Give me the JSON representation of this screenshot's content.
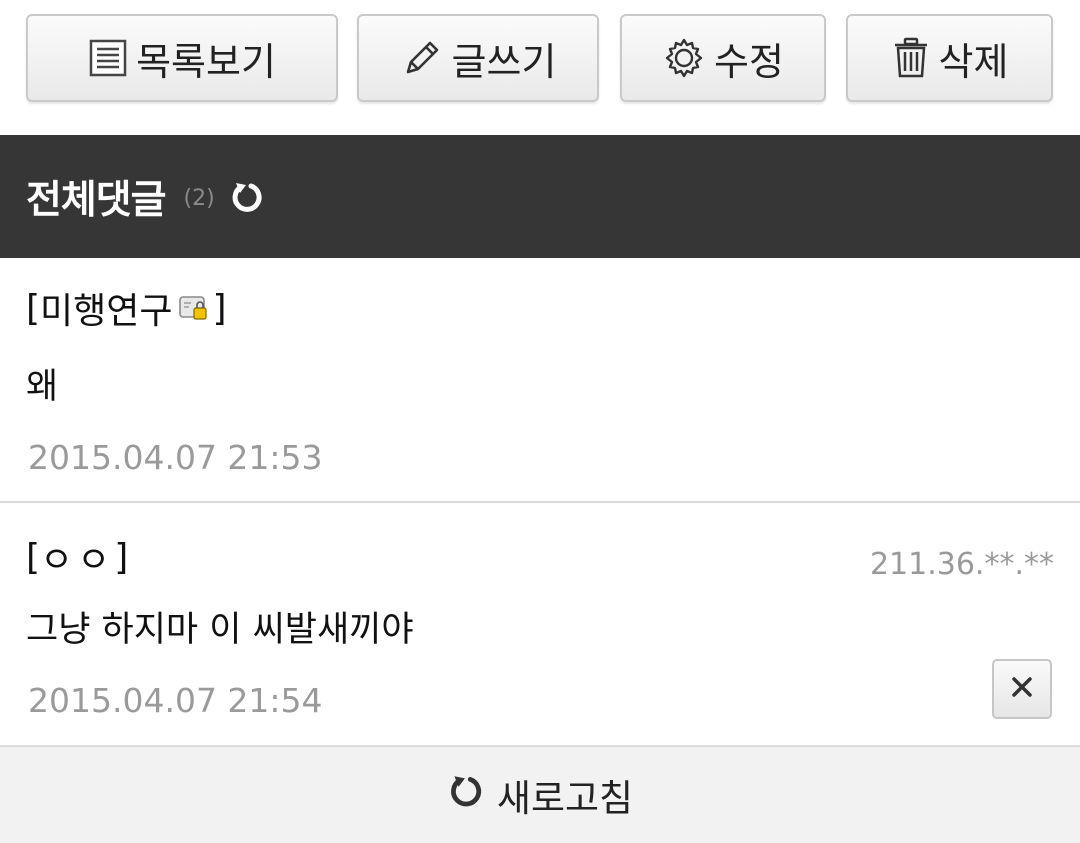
{
  "toolbar": {
    "list_label": "목록보기",
    "write_label": "글쓰기",
    "edit_label": "수정",
    "delete_label": "삭제"
  },
  "comments_header": {
    "title": "전체댓글",
    "count": "(2)"
  },
  "comments": [
    {
      "author": "미행연구",
      "text": "왜",
      "timestamp": "2015.04.07 21:53"
    },
    {
      "author": "ㅇㅇ",
      "ip": "211.36.**.**",
      "text": "그냥 하지마 이 씨발새끼야",
      "timestamp": "2015.04.07 21:54"
    }
  ],
  "footer": {
    "refresh_label": "새로고침"
  },
  "icons": {
    "list": "list-icon",
    "write": "pencil-icon",
    "edit": "gear-icon",
    "delete": "trash-icon",
    "refresh": "refresh-icon",
    "close": "close-icon",
    "fixed_nick": "fixed-nickname-icon"
  },
  "colors": {
    "header_background": "#363636",
    "header_text": "#ffffff",
    "muted_text": "#9a9a9a",
    "footer_background": "#f2f2f2"
  }
}
